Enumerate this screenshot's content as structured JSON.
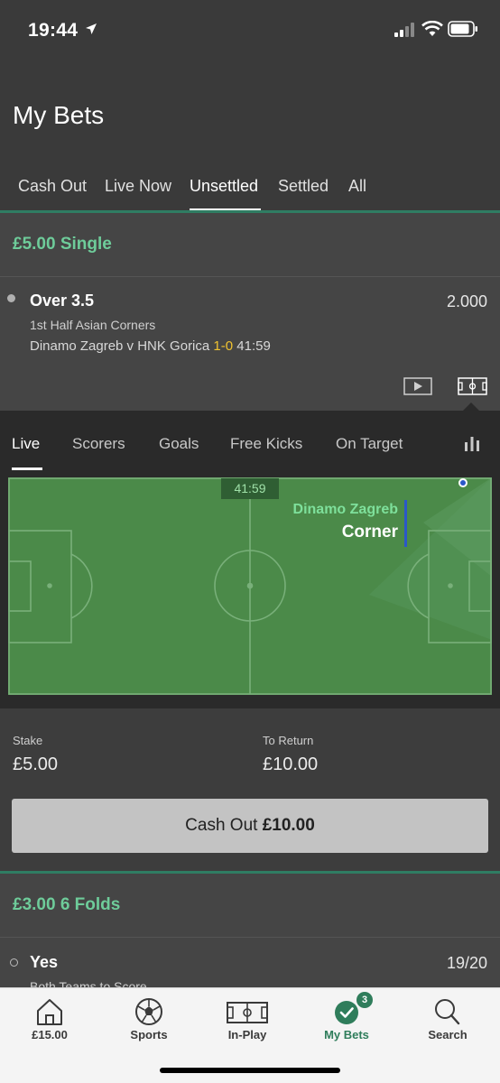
{
  "status_bar": {
    "time": "19:44"
  },
  "header": {
    "title": "My Bets",
    "tabs": [
      "Cash Out",
      "Live Now",
      "Unsettled",
      "Settled",
      "All"
    ],
    "active_tab": "Unsettled"
  },
  "bet1": {
    "title": "£5.00 Single",
    "selection": {
      "name": "Over 3.5",
      "odds": "2.000",
      "market": "1st Half Asian Corners",
      "event": "Dinamo Zagreb v HNK Gorica",
      "score": "1-0",
      "clock": "41:59"
    }
  },
  "tracker": {
    "tabs": [
      "Live",
      "Scorers",
      "Goals",
      "Free Kicks",
      "On Target"
    ],
    "active_tab": "Live",
    "clock": "41:59",
    "event_team": "Dinamo Zagreb",
    "event_type": "Corner"
  },
  "stake": {
    "stake_label": "Stake",
    "stake_value": "£5.00",
    "return_label": "To Return",
    "return_value": "£10.00",
    "cashout_prefix": "Cash Out",
    "cashout_amount": "£10.00"
  },
  "bet2": {
    "title": "£3.00 6 Folds",
    "selection": {
      "name": "Yes",
      "odds": "19/20",
      "market": "Both Teams to Score"
    }
  },
  "bottom_nav": {
    "items": [
      {
        "label": "£15.00",
        "icon": "home-icon"
      },
      {
        "label": "Sports",
        "icon": "football-icon"
      },
      {
        "label": "In-Play",
        "icon": "pitch-icon"
      },
      {
        "label": "My Bets",
        "icon": "check-circle-icon",
        "badge": "3"
      },
      {
        "label": "Search",
        "icon": "search-icon"
      }
    ],
    "active": "My Bets"
  },
  "colors": {
    "accent_green": "#6ecc9a",
    "brand_green": "#2f7d5b",
    "score_yellow": "#f0c230",
    "pitch_green": "#4a8a48"
  }
}
